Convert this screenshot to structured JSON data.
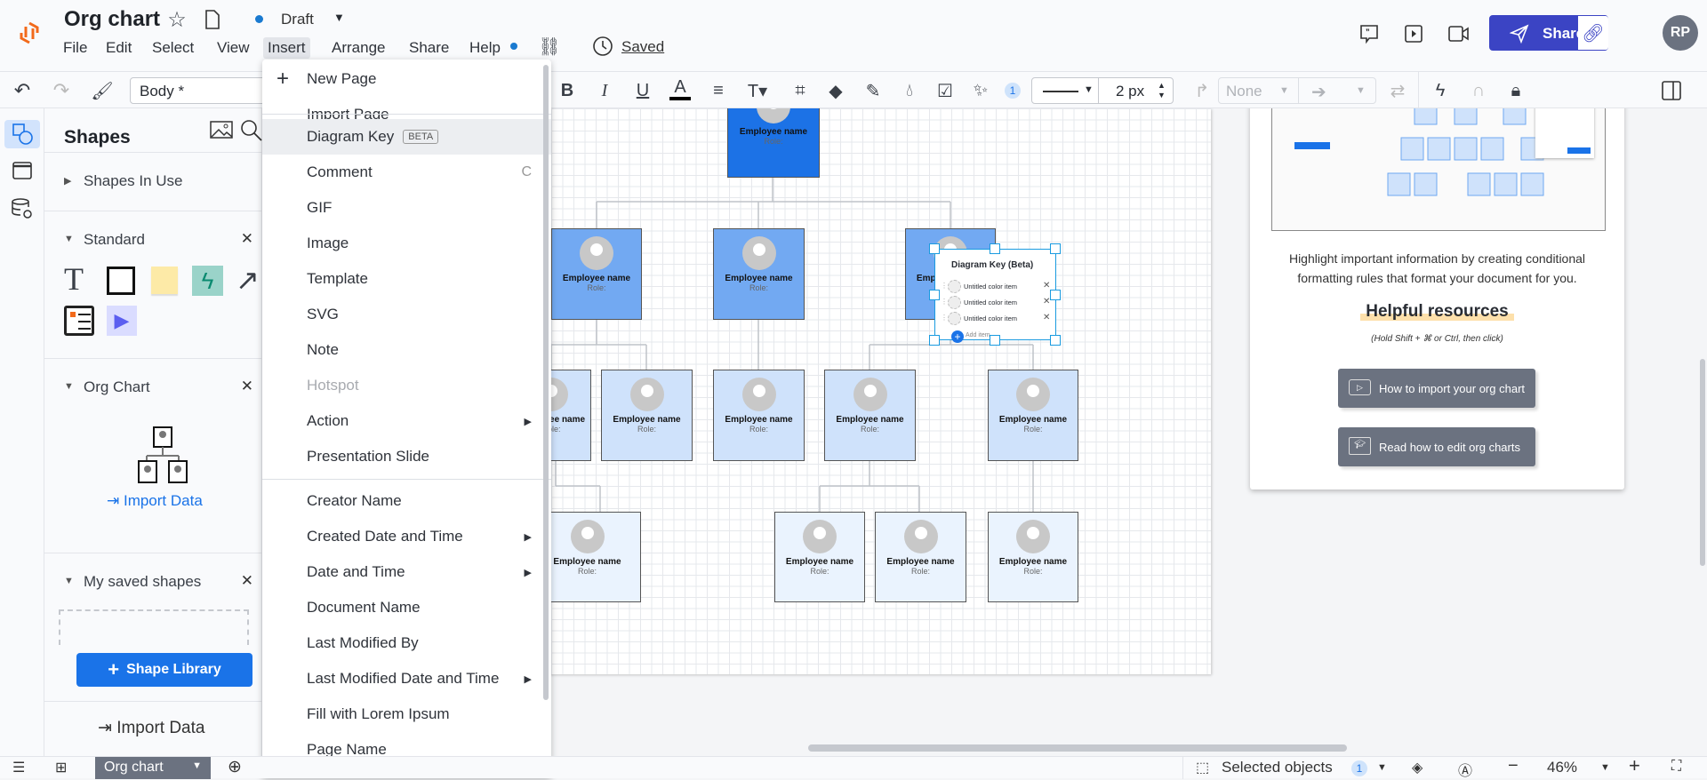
{
  "app": {
    "title": "Org chart",
    "status": "Draft",
    "saved": "Saved",
    "avatar": "RP",
    "share": "Share"
  },
  "menu": [
    "File",
    "Edit",
    "Select",
    "View",
    "Insert",
    "Arrange",
    "Share",
    "Help"
  ],
  "toolbar": {
    "font_style": "Body *",
    "line_width": "2 px",
    "endpoint": "None",
    "badge": "1"
  },
  "rail": [
    "shapes-icon",
    "page-icon",
    "data-link-icon"
  ],
  "panel": {
    "title": "Shapes",
    "sections": {
      "in_use": "Shapes In Use",
      "standard": "Standard",
      "org": "Org Chart",
      "saved": "My saved shapes"
    },
    "import_data": "Import Data",
    "shape_library": "Shape Library",
    "import_data_bottom": "Import Data"
  },
  "insert_menu": [
    {
      "label": "New Page",
      "icon": "plus"
    },
    {
      "label": "Import Page"
    },
    {
      "label": "Diagram Key",
      "badge": "BETA",
      "highlighted": true
    },
    {
      "label": "Comment",
      "shortcut": "C"
    },
    {
      "label": "GIF"
    },
    {
      "label": "Image"
    },
    {
      "label": "Template"
    },
    {
      "label": "SVG"
    },
    {
      "label": "Note"
    },
    {
      "label": "Hotspot",
      "disabled": true
    },
    {
      "label": "Action",
      "submenu": true
    },
    {
      "label": "Presentation Slide"
    },
    {
      "label": "Creator Name"
    },
    {
      "label": "Created Date and Time",
      "submenu": true
    },
    {
      "label": "Date and Time",
      "submenu": true
    },
    {
      "label": "Document Name"
    },
    {
      "label": "Last Modified By"
    },
    {
      "label": "Last Modified Date and Time",
      "submenu": true
    },
    {
      "label": "Fill with Lorem Ipsum"
    },
    {
      "label": "Page Name"
    }
  ],
  "node": {
    "name": "Employee name",
    "role": "Role:"
  },
  "diagram_key": {
    "title": "Diagram Key (Beta)",
    "items": [
      "Untitled color item",
      "Untitled color item",
      "Untitled color item"
    ],
    "add": "Add item"
  },
  "rpanel": {
    "desc1": "Highlight important information by creating conditional",
    "desc2": "formatting rules that format your document for you.",
    "heading": "Helpful resources",
    "hint": "(Hold Shift + ⌘ or Ctrl, then click)",
    "btn1": "How to import your org chart",
    "btn2": "Read how to edit org charts"
  },
  "bottom": {
    "tab": "Org chart",
    "selected": "Selected objects",
    "selected_count": "1",
    "zoom": "46%"
  },
  "colors": {
    "accent": "#3b44c4",
    "node_l1": "#1c72e6",
    "node_l2": "#72a9f2",
    "node_l3": "#cfe2fb",
    "node_l4": "#eaf3fe",
    "link": "#1a73e8"
  }
}
